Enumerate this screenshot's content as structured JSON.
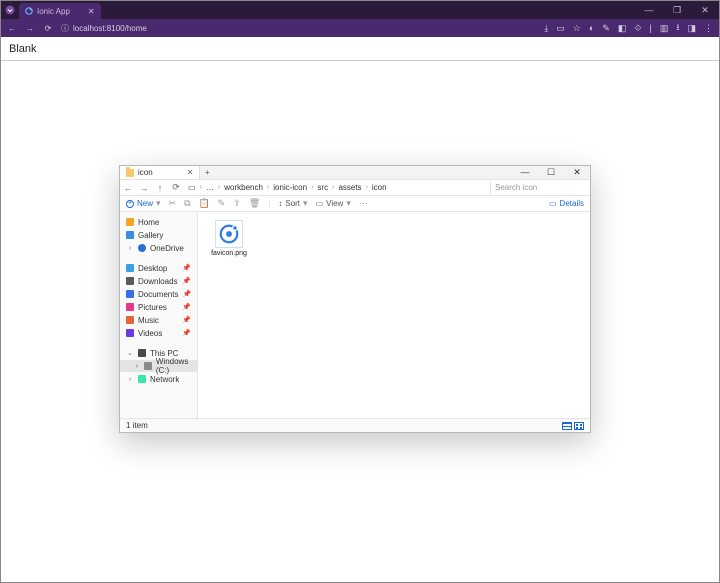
{
  "browser": {
    "tab_title": "Ionic App",
    "url": "localhost:8100/home",
    "win": {
      "min": "—",
      "max": "❐",
      "close": "✕"
    }
  },
  "page": {
    "header": "Blank"
  },
  "explorer": {
    "tab_title": "icon",
    "win": {
      "min": "—",
      "max": "☐",
      "close": "✕"
    },
    "breadcrumb": [
      "…",
      "workbench",
      "ionic-icon",
      "src",
      "assets",
      "icon"
    ],
    "search_placeholder": "Search icon",
    "toolbar": {
      "new": "New",
      "sort": "Sort",
      "view": "View",
      "details": "Details"
    },
    "sidebar": {
      "home": "Home",
      "gallery": "Gallery",
      "onedrive": "OneDrive",
      "desktop": "Desktop",
      "downloads": "Downloads",
      "documents": "Documents",
      "pictures": "Pictures",
      "music": "Music",
      "videos": "Videos",
      "this_pc": "This PC",
      "drive_c": "Windows (C:)",
      "network": "Network"
    },
    "files": [
      {
        "name": "favicon.png"
      }
    ],
    "status": "1 item"
  }
}
